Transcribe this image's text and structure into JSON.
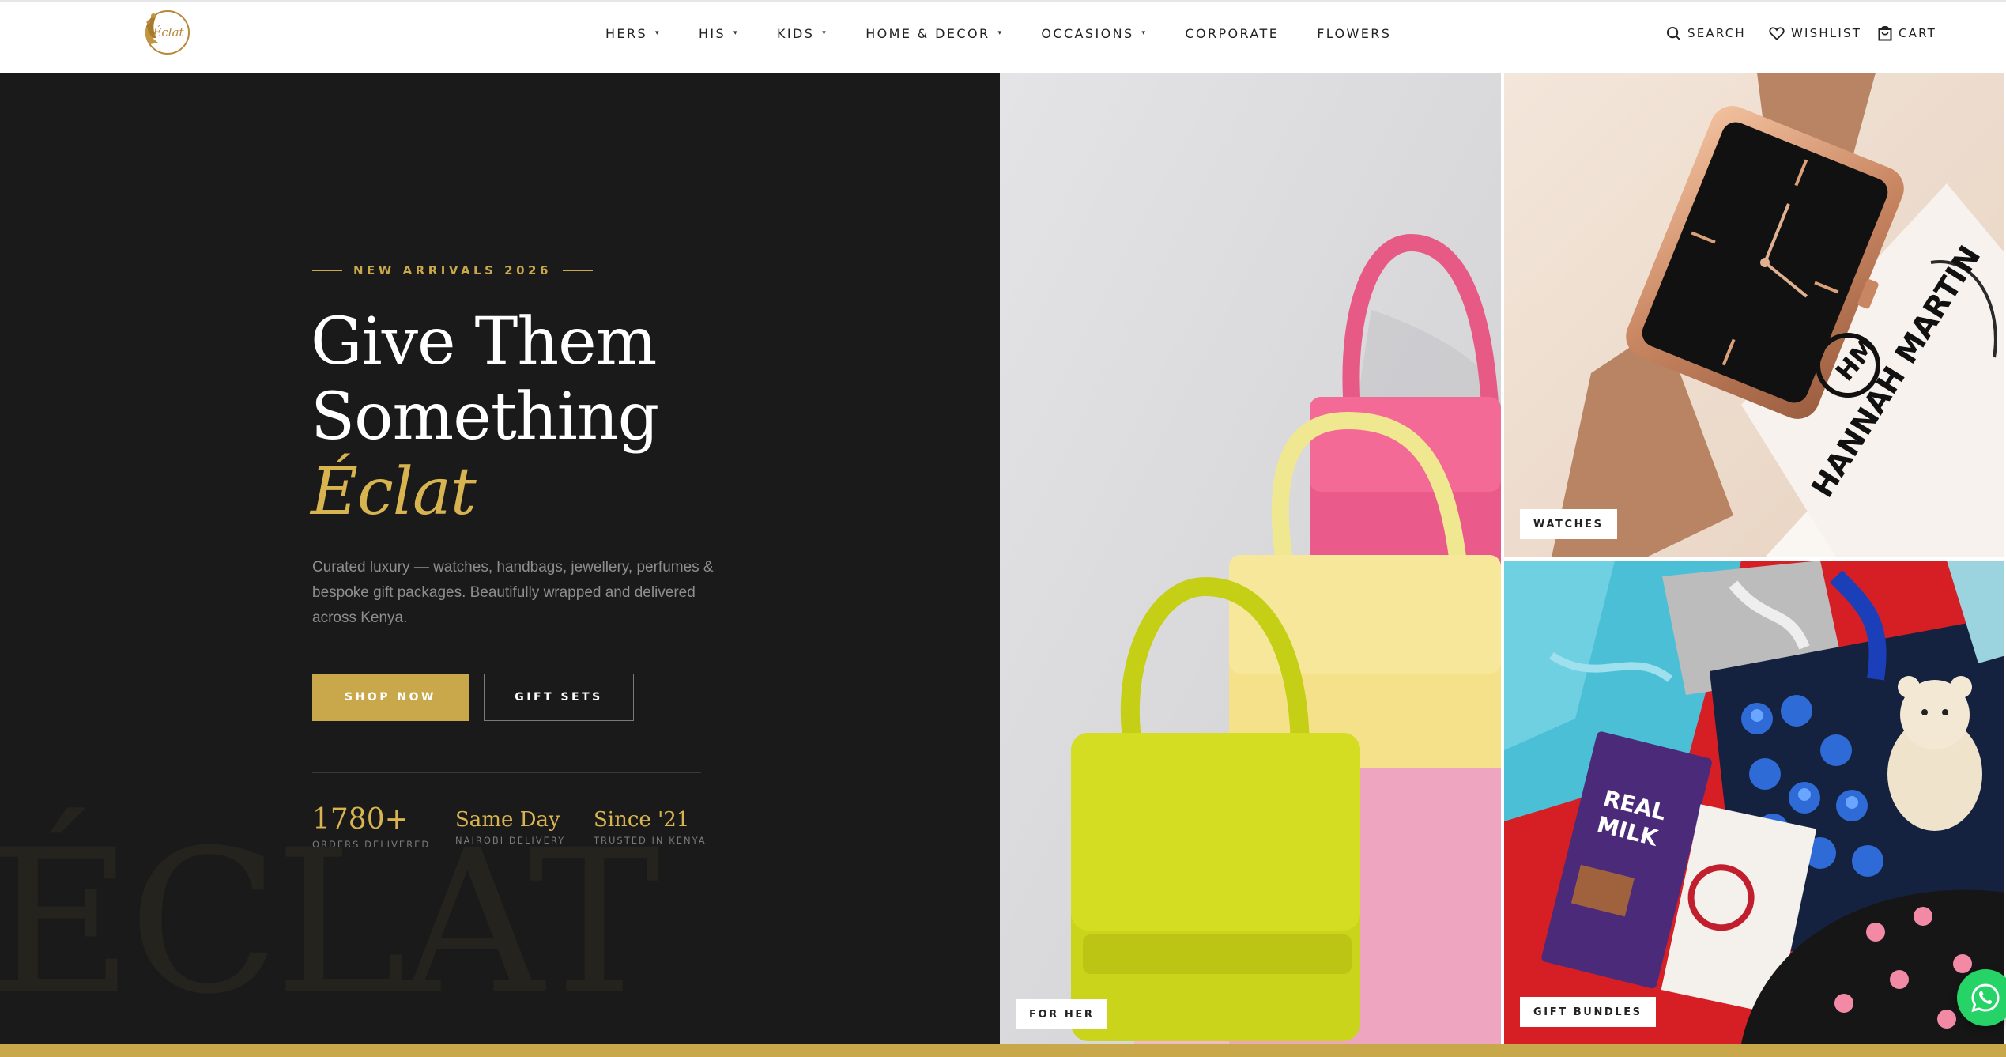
{
  "header": {
    "nav": [
      {
        "label": "HERS",
        "has_dropdown": true
      },
      {
        "label": "HIS",
        "has_dropdown": true
      },
      {
        "label": "KIDS",
        "has_dropdown": true
      },
      {
        "label": "HOME & DECOR",
        "has_dropdown": true
      },
      {
        "label": "OCCASIONS",
        "has_dropdown": true
      },
      {
        "label": "CORPORATE",
        "has_dropdown": false
      },
      {
        "label": "FLOWERS",
        "has_dropdown": false
      }
    ],
    "utilities": {
      "search": "SEARCH",
      "wishlist": "WISHLIST",
      "cart": "CART"
    },
    "dropdown_caret": "▾"
  },
  "hero": {
    "eyebrow": "NEW ARRIVALS 2026",
    "headline_line1": "Give Them",
    "headline_line2": "Something",
    "headline_accent": "Éclat",
    "description": "Curated luxury — watches, handbags, jewellery, perfumes & bespoke gift packages. Beautifully wrapped and delivered across Kenya.",
    "primary_button": "SHOP NOW",
    "secondary_button": "GIFT SETS",
    "stats": [
      {
        "value": "1780+",
        "label": "ORDERS DELIVERED"
      },
      {
        "value": "Same Day",
        "label": "NAIROBI DELIVERY"
      },
      {
        "value": "Since '21",
        "label": "TRUSTED IN KENYA"
      }
    ],
    "watermark": "ÉCLAT"
  },
  "tiles": {
    "for_her": "FOR HER",
    "watches": "WATCHES",
    "gift_bundles": "GIFT BUNDLES"
  },
  "colors": {
    "accent_gold": "#c9a84c",
    "dark_panel": "#1a1a1a",
    "whatsapp_green": "#25d366"
  }
}
